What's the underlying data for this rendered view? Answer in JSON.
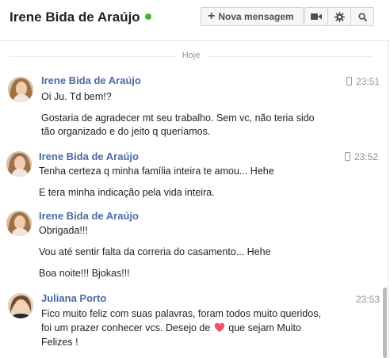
{
  "header": {
    "title": "Irene Bida de Araújo",
    "new_message_label": "Nova mensagem",
    "icons": [
      "video-icon",
      "gear-icon",
      "search-icon"
    ],
    "online_color": "#42b72a"
  },
  "conversation": {
    "date_separator": "Hoje",
    "groups": [
      {
        "sender": "Irene Bida de Araújo",
        "time": "23:51",
        "mobile": true,
        "messages": [
          "Oi Ju. Td bem!?",
          "Gostaria de agradecer mt seu trabalho. Sem vc, não teria sido",
          "tão organizado e do jeito q queríamos."
        ]
      },
      {
        "sender": "Irene Bida de Araújo",
        "time": "23:52",
        "mobile": true,
        "messages": [
          "Tenha certeza q minha família inteira te amou... Hehe",
          "E tera minha indicação pela vida inteira."
        ]
      },
      {
        "sender": "Irene Bida de Araújo",
        "messages": [
          "Obrigada!!!",
          "Vou até sentir falta da correria do casamento... Hehe",
          "Boa noite!!! Bjokas!!!"
        ]
      },
      {
        "sender": "Juliana Porto",
        "time": "23:53",
        "mobile": false,
        "messages": [
          "Fico muito feliz com suas palavras, foram todos muito queridos,",
          "foi um prazer conhecer vcs. Desejo de",
          "que sejam Muito",
          "Felizes !"
        ]
      }
    ]
  },
  "colors": {
    "sender_name": "#4b6ba2",
    "heart": "#f25268"
  }
}
